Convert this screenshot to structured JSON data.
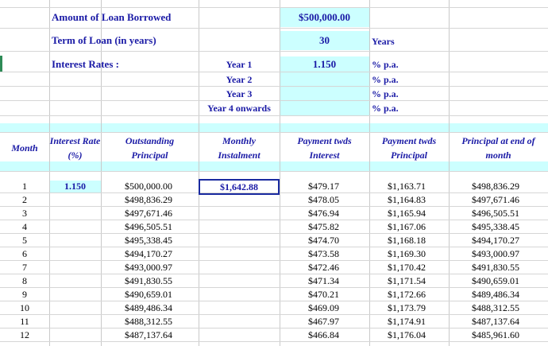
{
  "inputs": {
    "loan_label": "Amount of Loan Borrowed",
    "loan_value": "$500,000.00",
    "term_label": "Term of Loan (in years)",
    "term_value": "30",
    "term_unit": "Years",
    "rates_label": "Interest Rates :",
    "rates": [
      {
        "label": "Year 1",
        "value": "1.150",
        "unit": "% p.a."
      },
      {
        "label": "Year 2",
        "value": "",
        "unit": "% p.a."
      },
      {
        "label": "Year 3",
        "value": "",
        "unit": "% p.a."
      },
      {
        "label": "Year 4 onwards",
        "value": "",
        "unit": "% p.a."
      }
    ]
  },
  "table": {
    "headers": {
      "month": "Month",
      "rate": "Interest Rate (%)",
      "outstanding": "Outstanding Principal",
      "instalment": "Monthly Instalment",
      "interest": "Payment twds Interest",
      "principal": "Payment twds Principal",
      "end": "Principal at end of month"
    },
    "first_rate": "1.150",
    "instalment_value": "$1,642.88",
    "rows": [
      {
        "month": "1",
        "outstanding": "$500,000.00",
        "interest": "$479.17",
        "principal": "$1,163.71",
        "end": "$498,836.29"
      },
      {
        "month": "2",
        "outstanding": "$498,836.29",
        "interest": "$478.05",
        "principal": "$1,164.83",
        "end": "$497,671.46"
      },
      {
        "month": "3",
        "outstanding": "$497,671.46",
        "interest": "$476.94",
        "principal": "$1,165.94",
        "end": "$496,505.51"
      },
      {
        "month": "4",
        "outstanding": "$496,505.51",
        "interest": "$475.82",
        "principal": "$1,167.06",
        "end": "$495,338.45"
      },
      {
        "month": "5",
        "outstanding": "$495,338.45",
        "interest": "$474.70",
        "principal": "$1,168.18",
        "end": "$494,170.27"
      },
      {
        "month": "6",
        "outstanding": "$494,170.27",
        "interest": "$473.58",
        "principal": "$1,169.30",
        "end": "$493,000.97"
      },
      {
        "month": "7",
        "outstanding": "$493,000.97",
        "interest": "$472.46",
        "principal": "$1,170.42",
        "end": "$491,830.55"
      },
      {
        "month": "8",
        "outstanding": "$491,830.55",
        "interest": "$471.34",
        "principal": "$1,171.54",
        "end": "$490,659.01"
      },
      {
        "month": "9",
        "outstanding": "$490,659.01",
        "interest": "$470.21",
        "principal": "$1,172.66",
        "end": "$489,486.34"
      },
      {
        "month": "10",
        "outstanding": "$489,486.34",
        "interest": "$469.09",
        "principal": "$1,173.79",
        "end": "$488,312.55"
      },
      {
        "month": "11",
        "outstanding": "$488,312.55",
        "interest": "$467.97",
        "principal": "$1,174.91",
        "end": "$487,137.64"
      },
      {
        "month": "12",
        "outstanding": "$487,137.64",
        "interest": "$466.84",
        "principal": "$1,176.04",
        "end": "$485,961.60"
      }
    ]
  }
}
